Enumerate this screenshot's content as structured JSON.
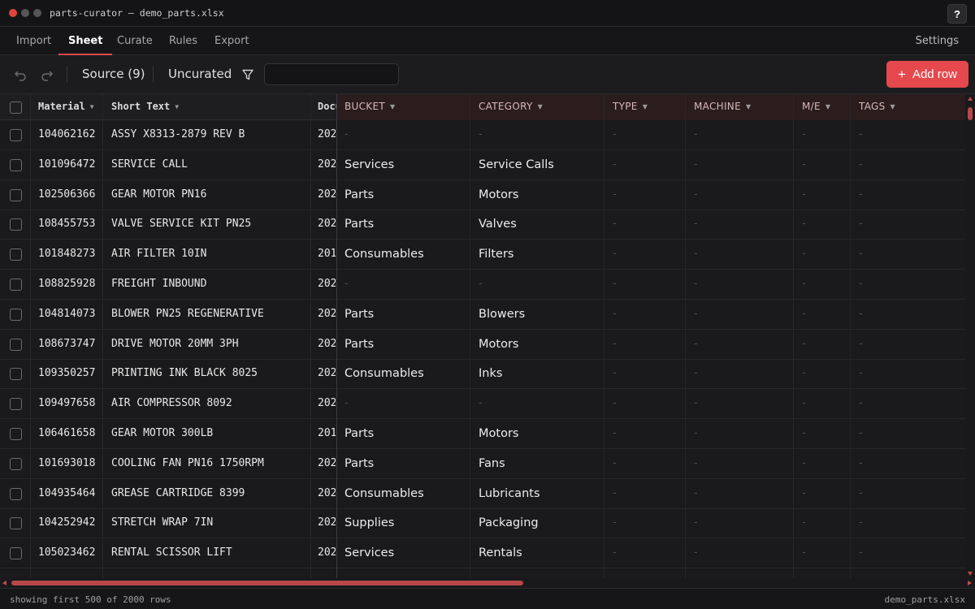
{
  "window": {
    "title": "parts-curator — demo_parts.xlsx",
    "help_label": "?"
  },
  "nav": {
    "tabs": [
      {
        "label": "Import"
      },
      {
        "label": "Sheet",
        "active": true
      },
      {
        "label": "Curate"
      },
      {
        "label": "Rules"
      },
      {
        "label": "Export"
      }
    ],
    "settings_label": "Settings"
  },
  "toolbar": {
    "source_label": "Source (9)",
    "uncurated_label": "Uncurated",
    "search_value": "",
    "add_row_label": "Add row",
    "add_row_icon": "plus-icon"
  },
  "colors": {
    "accent": "#e5484d",
    "curated_header_bg": "#2b1c1e"
  },
  "table": {
    "source_columns": [
      "Material",
      "Short Text",
      "Docu"
    ],
    "curated_columns": [
      "BUCKET",
      "CATEGORY",
      "TYPE",
      "MACHINE",
      "M/E",
      "TAGS"
    ],
    "empty_marker": "-",
    "rows": [
      {
        "material": "104062162",
        "short_text": "ASSY X8313-2879 REV B",
        "doc": "202",
        "bucket": "-",
        "category": "-"
      },
      {
        "material": "101096472",
        "short_text": "SERVICE CALL",
        "doc": "202",
        "bucket": "Services",
        "category": "Service Calls"
      },
      {
        "material": "102506366",
        "short_text": "GEAR MOTOR PN16",
        "doc": "202",
        "bucket": "Parts",
        "category": "Motors"
      },
      {
        "material": "108455753",
        "short_text": "VALVE SERVICE KIT PN25",
        "doc": "202",
        "bucket": "Parts",
        "category": "Valves"
      },
      {
        "material": "101848273",
        "short_text": "AIR FILTER 10IN",
        "doc": "201",
        "bucket": "Consumables",
        "category": "Filters"
      },
      {
        "material": "108825928",
        "short_text": "FREIGHT INBOUND",
        "doc": "202",
        "bucket": "-",
        "category": "-"
      },
      {
        "material": "104814073",
        "short_text": "BLOWER PN25 REGENERATIVE",
        "doc": "202",
        "bucket": "Parts",
        "category": "Blowers"
      },
      {
        "material": "108673747",
        "short_text": "DRIVE MOTOR 20MM 3PH",
        "doc": "202",
        "bucket": "Parts",
        "category": "Motors"
      },
      {
        "material": "109350257",
        "short_text": "PRINTING INK BLACK 8025",
        "doc": "202",
        "bucket": "Consumables",
        "category": "Inks"
      },
      {
        "material": "109497658",
        "short_text": "AIR COMPRESSOR 8092",
        "doc": "202",
        "bucket": "-",
        "category": "-"
      },
      {
        "material": "106461658",
        "short_text": "GEAR MOTOR 300LB",
        "doc": "201",
        "bucket": "Parts",
        "category": "Motors"
      },
      {
        "material": "101693018",
        "short_text": "COOLING FAN PN16 1750RPM",
        "doc": "202",
        "bucket": "Parts",
        "category": "Fans"
      },
      {
        "material": "104935464",
        "short_text": "GREASE CARTRIDGE 8399",
        "doc": "202",
        "bucket": "Consumables",
        "category": "Lubricants"
      },
      {
        "material": "104252942",
        "short_text": "STRETCH WRAP 7IN",
        "doc": "202",
        "bucket": "Supplies",
        "category": "Packaging"
      },
      {
        "material": "105023462",
        "short_text": "RENTAL SCISSOR LIFT",
        "doc": "202",
        "bucket": "Services",
        "category": "Rentals"
      }
    ]
  },
  "status": {
    "left": "showing first 500 of 2000 rows",
    "right": "demo_parts.xlsx"
  }
}
